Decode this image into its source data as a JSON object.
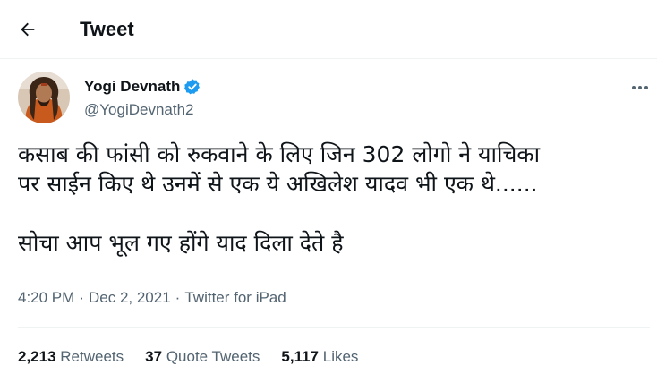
{
  "header": {
    "title": "Tweet",
    "back_icon": "arrow-left-icon"
  },
  "author": {
    "display_name": "Yogi Devnath",
    "handle": "@YogiDevnath2",
    "verified_icon": "verified-badge-icon",
    "verified_color": "#1d9bf0"
  },
  "tweet": {
    "lines": [
      "कसाब की फांसी को रुकवाने के लिए जिन 302 लोगो ने याचिका",
      "पर साईन किए थे उनमें से एक ये अखिलेश यादव भी एक थे......",
      "सोचा आप भूल गए होंगे याद दिला देते है"
    ],
    "time": "4:20 PM",
    "separator": "·",
    "date": "Dec 2, 2021",
    "source": "Twitter for iPad"
  },
  "stats": {
    "retweets_count": "2,213",
    "retweets_label": "Retweets",
    "quotes_count": "37",
    "quotes_label": "Quote Tweets",
    "likes_count": "5,117",
    "likes_label": "Likes"
  },
  "colors": {
    "text_primary": "#0f1419",
    "text_secondary": "#536471",
    "divider": "#eff3f4"
  }
}
